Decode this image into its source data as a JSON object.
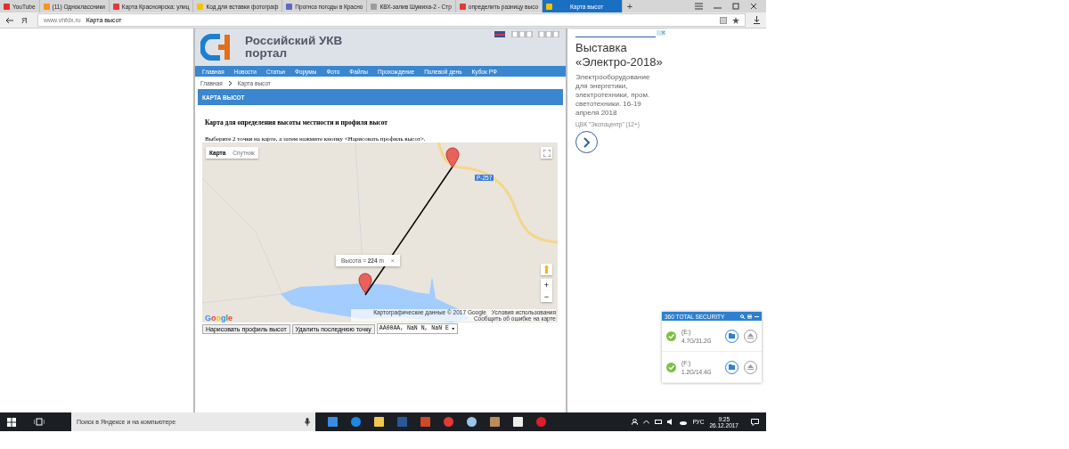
{
  "browser": {
    "tabs": [
      {
        "title": "YouTube",
        "selected": false,
        "color": "#e52d27"
      },
      {
        "title": "(11) Одноклассники",
        "selected": false,
        "color": "#f7931e"
      },
      {
        "title": "Карта Красноярска: улиц",
        "selected": false,
        "color": "#e53935"
      },
      {
        "title": "Код для вставки фотограф",
        "selected": false,
        "color": "#f5c400"
      },
      {
        "title": "Прогноз погоды в Красно",
        "selected": false,
        "color": "#5c6bc0"
      },
      {
        "title": "КВХ-залив Шумиха-2 - Стр",
        "selected": false,
        "color": "#9e9e9e"
      },
      {
        "title": "определить разницу высо",
        "selected": false,
        "color": "#e53935"
      },
      {
        "title": "Карта высот",
        "selected": true,
        "color": "#f5c400"
      }
    ],
    "new_tab": "+",
    "yandex": "Я",
    "address": {
      "domain": "www.vhfdx.ru",
      "title": "Карта высот"
    }
  },
  "site": {
    "logo_line1": "Российский УКВ",
    "logo_line2": "портал",
    "nav": [
      "Главная",
      "Новости",
      "Статьи",
      "Форумы",
      "Фото",
      "Файлы",
      "Прохождение",
      "Полевой день",
      "Кубок РФ"
    ],
    "breadcrumb": [
      "Главная",
      "Карта высот"
    ],
    "section_title": "КАРТА ВЫСОТ",
    "heading": "Карта для определения высоты местности и профиля высот",
    "instruction": "Выберите 2 точки на карте, а затем нажмите кнопку <Нарисовать профиль высот>.",
    "map": {
      "types": [
        {
          "label": "Карта",
          "selected": true
        },
        {
          "label": "Спутник",
          "selected": false
        }
      ],
      "road_label": "Р-257",
      "popup": "Высота = **224** m",
      "popup_close": "×",
      "zoom_in": "+",
      "zoom_out": "−",
      "logo": "Google",
      "attribution": [
        "Картографические данные © 2017 Google",
        "Условия использования",
        "Сообщить об ошибке на карте"
      ]
    },
    "buttons": [
      "Нарисовать профиль высот",
      "Удалить последнюю точку"
    ],
    "select": "AA00AA, NaN N, NaN E",
    "select_arrow": "▾"
  },
  "ad": {
    "title": "Выставка «Электро-2018»",
    "text": "Электрооборудование для энергетики, электротехники, пром. светотехники. 16-19 апреля 2018",
    "source": "ЦВК \"Экспоцентр\" (12+)"
  },
  "security": {
    "title": "360 TOTAL SECURITY",
    "drives": [
      {
        "label": "(E:)",
        "usage": "4.7G/31.2G"
      },
      {
        "label": "(F:)",
        "usage": "1.2G/14.4G"
      }
    ]
  },
  "taskbar": {
    "search": "Поиск в Яндексе и на компьютере",
    "lang": "РУС",
    "time": "9:25",
    "date": "26.12.2017"
  }
}
